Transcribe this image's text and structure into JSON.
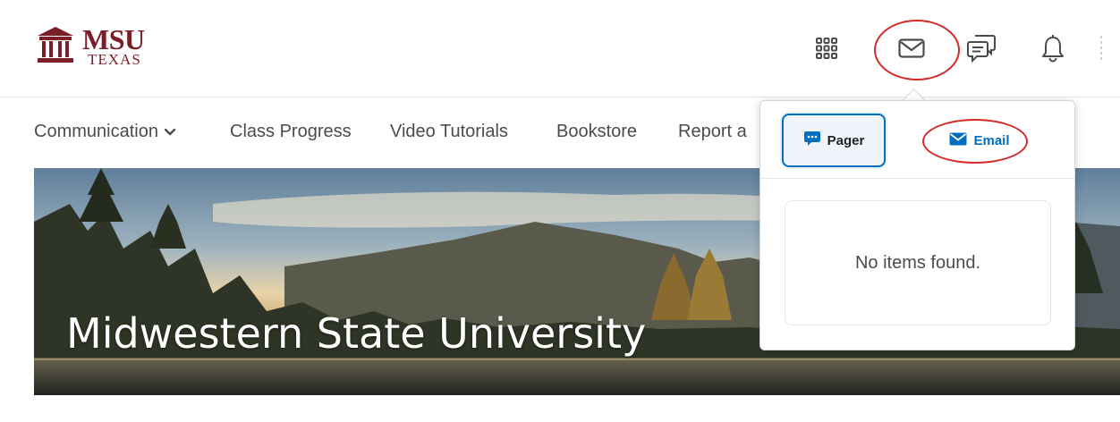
{
  "logo": {
    "line1": "MSU",
    "line2": "TEXAS"
  },
  "header_icons": [
    "waffle-grid-icon",
    "envelope-icon",
    "chat-bubbles-icon",
    "bell-icon"
  ],
  "navbar": {
    "items": [
      {
        "label": "Communication",
        "has_dropdown": true
      },
      {
        "label": "Class Progress"
      },
      {
        "label": "Video Tutorials"
      },
      {
        "label": "Bookstore"
      },
      {
        "label": "Report a"
      }
    ]
  },
  "banner": {
    "title": "Midwestern State University"
  },
  "dropdown": {
    "tabs": [
      {
        "label": "Pager",
        "selected": true,
        "icon": "pager-icon"
      },
      {
        "label": "Email",
        "selected": false,
        "icon": "envelope-icon"
      }
    ],
    "empty_message": "No items found."
  },
  "colors": {
    "brand": "#7a1f27",
    "accent": "#006fbf",
    "annotation": "#d32a2a"
  }
}
